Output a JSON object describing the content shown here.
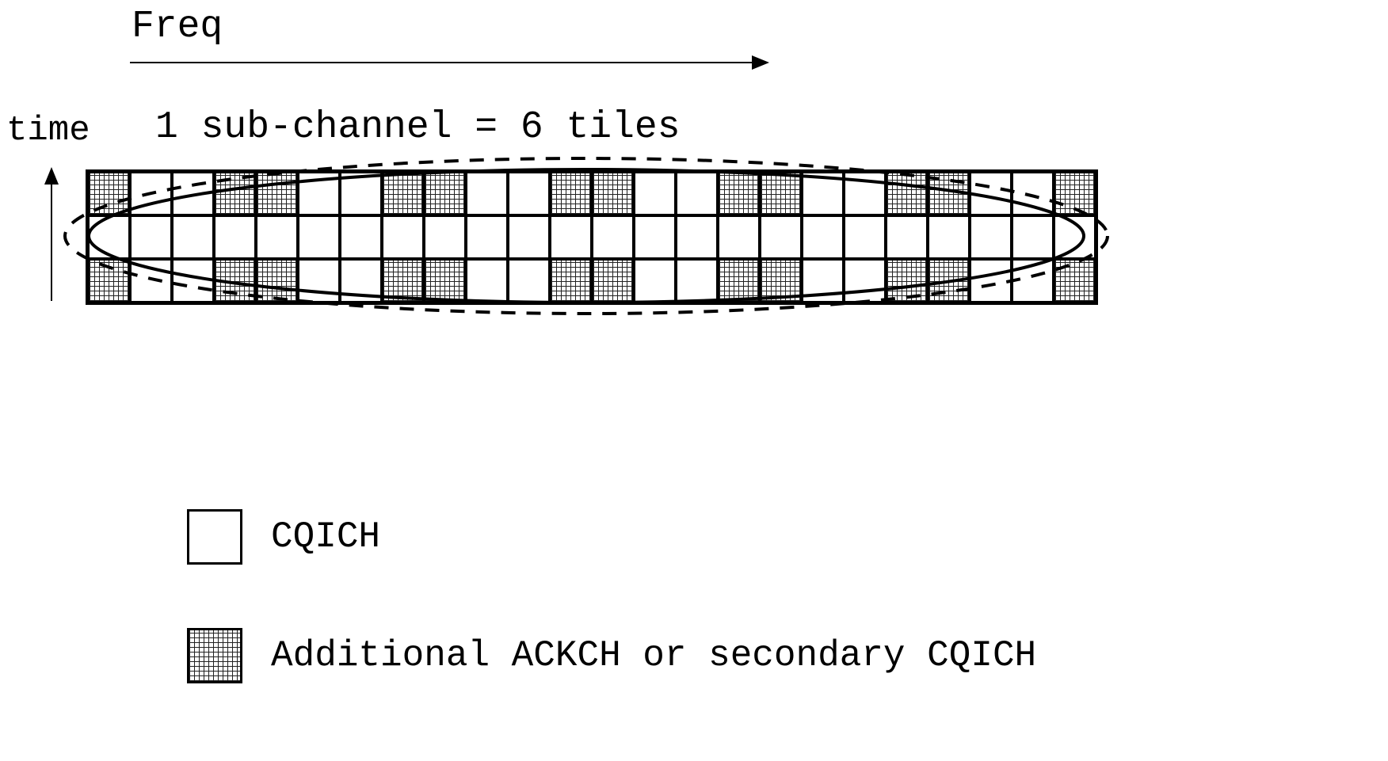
{
  "labels": {
    "freq": "Freq",
    "time": "time",
    "subchannel": "1 sub-channel = 6 tiles"
  },
  "legend": {
    "cqich": "CQICH",
    "ackch": "Additional ACKCH or secondary CQICH"
  },
  "chart_data": {
    "type": "diagram-grid",
    "cols": 24,
    "rows": 3,
    "x_axis": "Freq",
    "y_axis": "time",
    "annotation": "1 sub-channel = 6 tiles",
    "cell_types": {
      "0": "CQICH",
      "1": "Additional ACKCH or secondary CQICH"
    },
    "grid": [
      [
        1,
        0,
        0,
        1,
        1,
        0,
        0,
        1,
        1,
        0,
        0,
        1,
        1,
        0,
        0,
        1,
        1,
        0,
        0,
        1,
        1,
        0,
        0,
        1
      ],
      [
        0,
        0,
        0,
        0,
        0,
        0,
        0,
        0,
        0,
        0,
        0,
        0,
        0,
        0,
        0,
        0,
        0,
        0,
        0,
        0,
        0,
        0,
        0,
        0
      ],
      [
        1,
        0,
        0,
        1,
        1,
        0,
        0,
        1,
        1,
        0,
        0,
        1,
        1,
        0,
        0,
        1,
        1,
        0,
        0,
        1,
        1,
        0,
        0,
        1
      ]
    ],
    "solid_ellipse_tiles": "6 tiles forming one sub-channel (CQICH slot)",
    "dashed_ellipse_tiles": "slot boundary including additional ACKCH / secondary CQICH half-tiles"
  }
}
